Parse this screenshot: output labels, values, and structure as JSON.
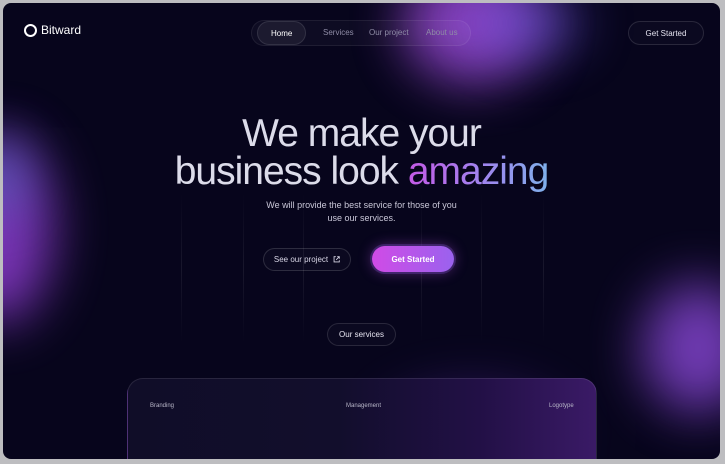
{
  "brand": {
    "name": "Bitward"
  },
  "nav": {
    "items": [
      "Home",
      "Services",
      "Our project",
      "About us"
    ],
    "active": "Home"
  },
  "header_cta": "Get Started",
  "hero": {
    "line1": "We make your",
    "line2_plain": "business look",
    "line2_accent": "amazing",
    "subtitle_line1": "We will provide the best service for those of you",
    "subtitle_line2": "use our services."
  },
  "buttons": {
    "secondary": "See our project",
    "primary": "Get Started"
  },
  "services_pill": "Our services",
  "card": {
    "labels": [
      "Branding",
      "Management",
      "Logotype"
    ]
  },
  "colors": {
    "background": "#07051c",
    "accent_start": "#d04be6",
    "accent_end": "#9a62ee"
  },
  "icons": {
    "brand": "logo-ring-icon",
    "external": "external-link-icon"
  }
}
